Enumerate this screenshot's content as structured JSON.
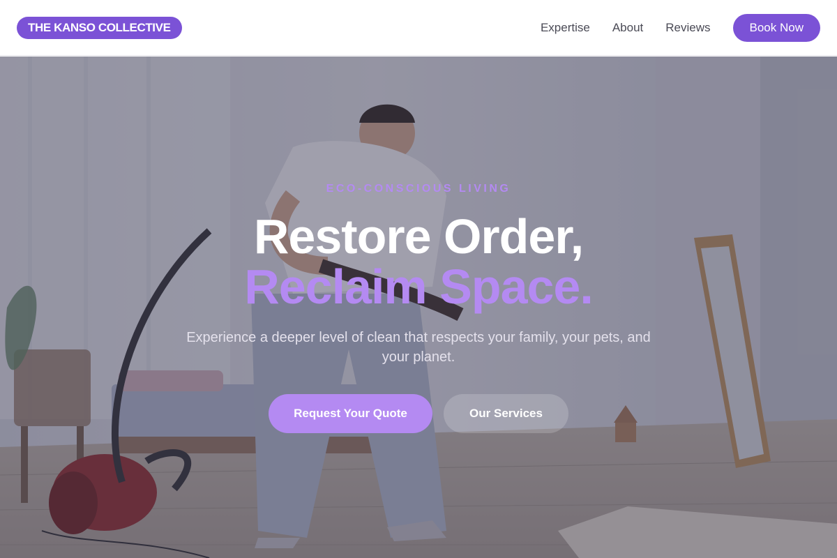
{
  "header": {
    "logo": "THE KANSO COLLECTIVE",
    "nav": [
      "Expertise",
      "About",
      "Reviews"
    ],
    "book_label": "Book Now"
  },
  "hero": {
    "eyebrow": "ECO-CONSCIOUS LIVING",
    "headline_line1": "Restore Order,",
    "headline_line2": "Reclaim Space.",
    "subtext": "Experience a deeper level of clean that respects your family, your pets, and your planet.",
    "primary_cta": "Request Your Quote",
    "secondary_cta": "Our Services"
  },
  "colors": {
    "brand": "#7b52d6",
    "accent": "#b48af2",
    "overlay": "#3a384e"
  },
  "icons": [
    "hero-background-photo"
  ]
}
